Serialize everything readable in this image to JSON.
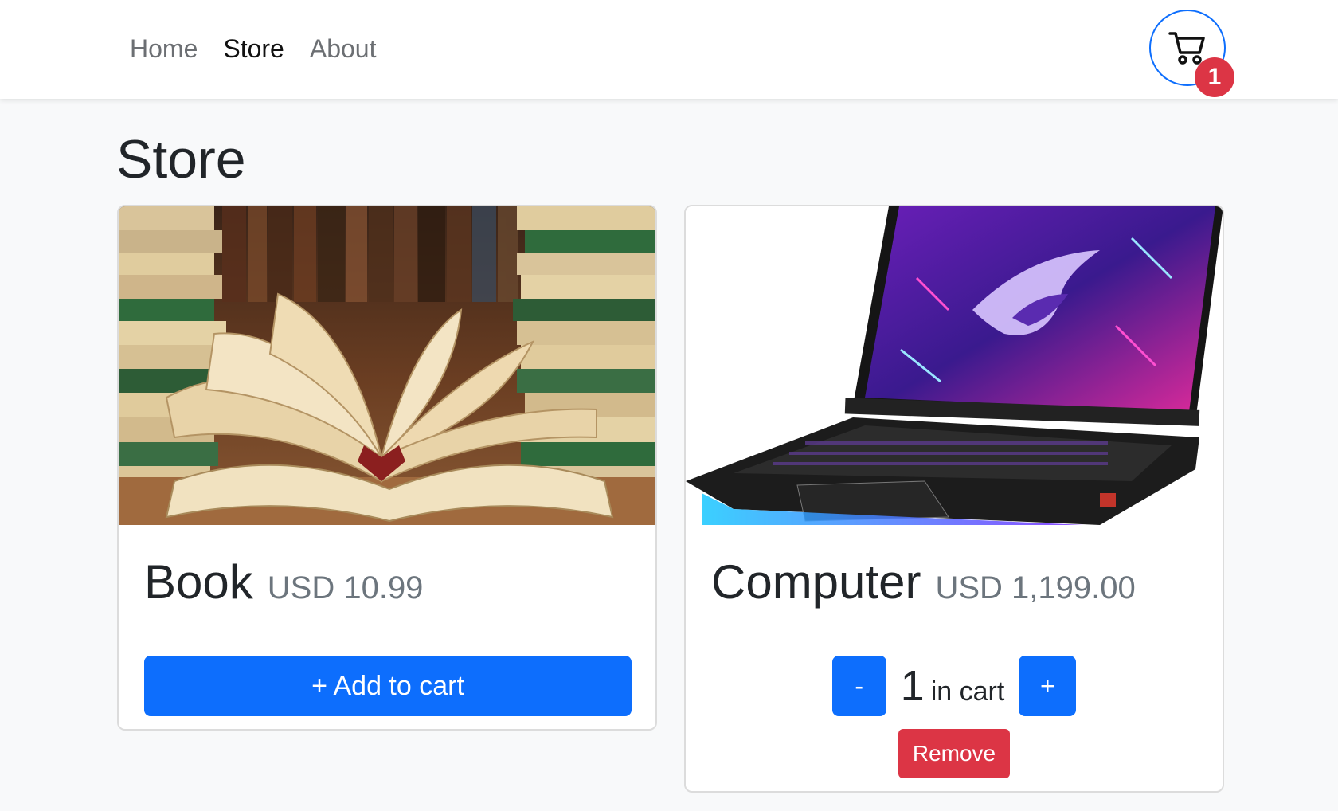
{
  "nav": {
    "links": [
      {
        "label": "Home"
      },
      {
        "label": "Store"
      },
      {
        "label": "About"
      }
    ],
    "cart_count": "1"
  },
  "page": {
    "title": "Store"
  },
  "products": [
    {
      "name": "Book",
      "price": "USD 10.99",
      "add_label": "+ Add to cart"
    },
    {
      "name": "Computer",
      "price": "USD 1,199.00",
      "quantity": "1",
      "quantity_label": "in cart",
      "decrement_label": "-",
      "increment_label": "+",
      "remove_label": "Remove"
    }
  ],
  "colors": {
    "primary": "#0d6efd",
    "danger": "#dc3545",
    "background": "#f8f9fa"
  },
  "icons": {
    "cart": "shopping-cart-icon"
  }
}
